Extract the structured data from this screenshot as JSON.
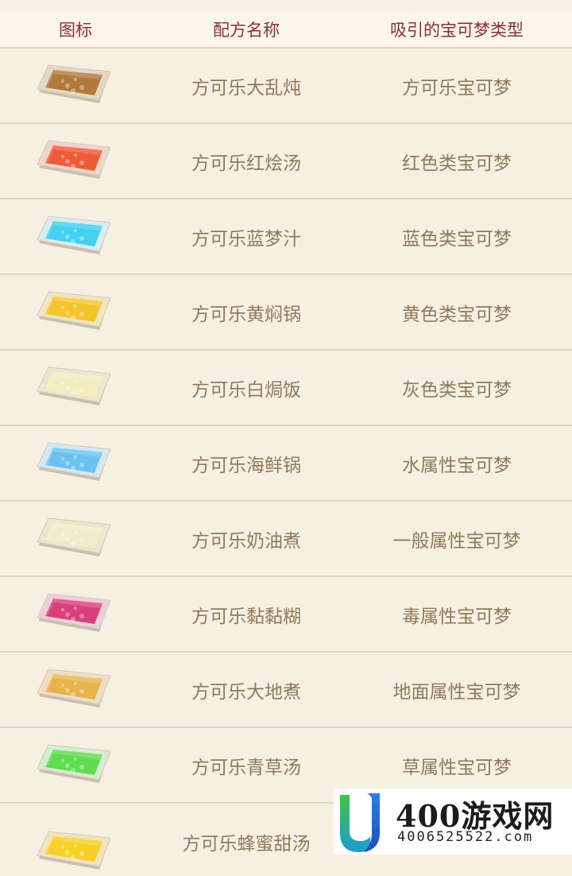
{
  "table": {
    "headers": [
      "图标",
      "配方名称",
      "吸引的宝可梦类型"
    ],
    "rows": [
      {
        "icon": "brown-stew-dish-icon",
        "recipe": "方可乐大乱炖",
        "attracts": "方可乐宝可梦"
      },
      {
        "icon": "red-soup-dish-icon",
        "recipe": "方可乐红烩汤",
        "attracts": "红色类宝可梦"
      },
      {
        "icon": "blue-soup-dish-icon",
        "recipe": "方可乐蓝梦汁",
        "attracts": "蓝色类宝可梦"
      },
      {
        "icon": "yellow-stew-dish-icon",
        "recipe": "方可乐黄焖锅",
        "attracts": "黄色类宝可梦"
      },
      {
        "icon": "white-rice-dish-icon",
        "recipe": "方可乐白焗饭",
        "attracts": "灰色类宝可梦"
      },
      {
        "icon": "seafood-dish-icon",
        "recipe": "方可乐海鲜锅",
        "attracts": "水属性宝可梦"
      },
      {
        "icon": "cream-stew-dish-icon",
        "recipe": "方可乐奶油煮",
        "attracts": "一般属性宝可梦"
      },
      {
        "icon": "sticky-paste-dish-icon",
        "recipe": "方可乐黏黏糊",
        "attracts": "毒属性宝可梦"
      },
      {
        "icon": "earth-stew-dish-icon",
        "recipe": "方可乐大地煮",
        "attracts": "地面属性宝可梦"
      },
      {
        "icon": "green-soup-dish-icon",
        "recipe": "方可乐青草汤",
        "attracts": "草属性宝可梦"
      },
      {
        "icon": "honey-soup-dish-icon",
        "recipe": "方可乐蜂蜜甜汤",
        "attracts": ""
      }
    ]
  },
  "colors": {
    "header_text": "#8a3038",
    "cell_text": "#8f7a5a",
    "page_bg": "#f6f0e3",
    "row_border": "#e5d7bb",
    "dish_fills": [
      "#b07a3c",
      "#ef5a3a",
      "#45cff0",
      "#f4c42a",
      "#f5ecc0",
      "#6cc2ef",
      "#f3ecc8",
      "#d8407a",
      "#e8b24c",
      "#5fdc50",
      "#f7cf26"
    ],
    "dish_frames": [
      "#e3d8c6",
      "#efd6c8",
      "#d7edf2",
      "#f1e5c2",
      "#eee7cf",
      "#d5e8f1",
      "#ece5cf",
      "#ecd0d9",
      "#eedfc3",
      "#d7edd0",
      "#f2e4bc"
    ]
  },
  "watermark": {
    "logo_icon": "site-logo-icon",
    "brand": "400游戏网",
    "domain": "4006525522.com"
  }
}
